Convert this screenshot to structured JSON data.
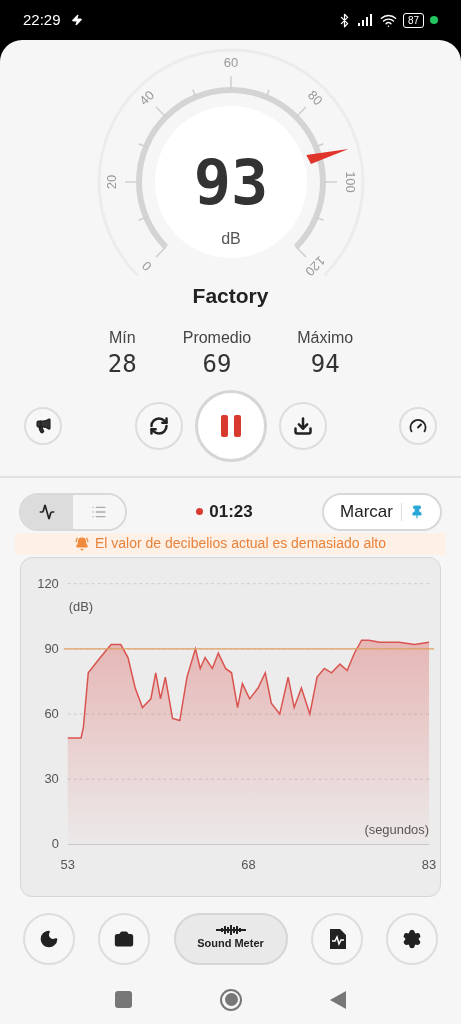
{
  "status_bar": {
    "time": "22:29",
    "battery": "87"
  },
  "gauge": {
    "ticks": [
      "0",
      "20",
      "40",
      "60",
      "80",
      "100",
      "120"
    ],
    "value": "93",
    "unit": "dB"
  },
  "location": "Factory",
  "stats": [
    {
      "label": "Mín",
      "value": "28"
    },
    {
      "label": "Promedio",
      "value": "69"
    },
    {
      "label": "Máximo",
      "value": "94"
    }
  ],
  "controls": {
    "recording": true
  },
  "view_toggle": [
    {
      "kind": "chart",
      "selected": true
    },
    {
      "kind": "list",
      "selected": false
    }
  ],
  "timer": "01:23",
  "mark_button": "Marcar",
  "alert": "El valor de decibelios actual es demasiado alto",
  "chart": {
    "chart_data": {
      "type": "area",
      "xlabel": "(segundos)",
      "ylabel": "(dB)",
      "x": [
        53.0,
        54.1,
        54.3,
        54.7,
        55.7,
        56.6,
        57.4,
        58.0,
        58.6,
        59.2,
        59.9,
        60.3,
        60.7,
        61.1,
        61.7,
        62.3,
        62.9,
        63.6,
        64.0,
        64.4,
        65.0,
        65.5,
        66.1,
        66.6,
        67.1,
        67.5,
        68.1,
        68.8,
        69.4,
        69.9,
        70.6,
        71.3,
        71.8,
        72.4,
        73.1,
        73.7,
        74.3,
        74.9,
        75.6,
        76.2,
        76.8,
        77.4,
        78.0,
        78.9,
        80.5,
        81.8,
        83.0
      ],
      "series": [
        {
          "color": "#d9534f",
          "values": [
            49,
            49,
            54,
            79,
            86,
            92,
            92,
            86,
            72,
            63,
            67,
            79,
            67,
            77,
            58,
            57,
            77,
            90,
            81,
            86,
            81,
            88,
            81,
            79,
            63,
            74,
            67,
            72,
            79,
            65,
            60,
            77,
            63,
            72,
            60,
            77,
            81,
            79,
            83,
            80,
            88,
            94,
            94,
            93,
            93,
            92,
            93
          ]
        }
      ],
      "xlim": [
        53,
        83
      ],
      "ylim": [
        0,
        120
      ],
      "xticks": [
        53,
        68,
        83
      ],
      "yticks": [
        0,
        30,
        60,
        90,
        120
      ],
      "grid": true,
      "ref_lines": [
        {
          "axis": "y",
          "value": 90,
          "color": "#e0a060"
        }
      ]
    }
  },
  "bottom_bar": {
    "center_label": "Sound Meter"
  }
}
